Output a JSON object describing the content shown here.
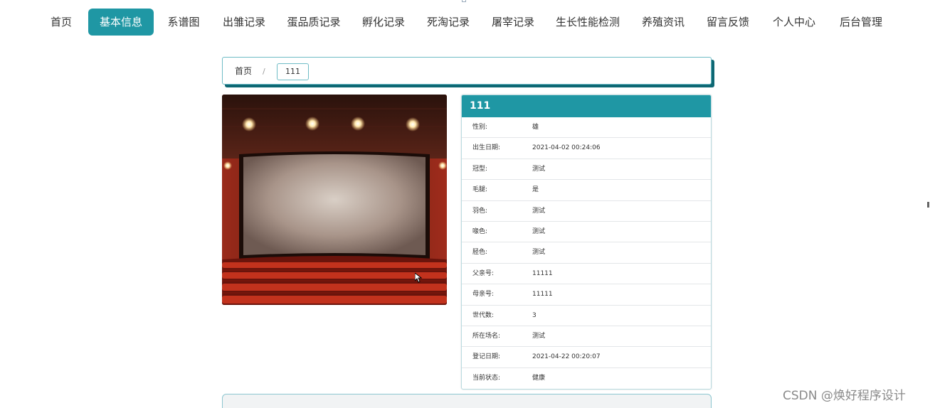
{
  "nav": {
    "items": [
      {
        "label": "首页"
      },
      {
        "label": "基本信息",
        "active": true
      },
      {
        "label": "系谱图"
      },
      {
        "label": "出雏记录"
      },
      {
        "label": "蛋品质记录"
      },
      {
        "label": "孵化记录"
      },
      {
        "label": "死淘记录"
      },
      {
        "label": "屠宰记录"
      },
      {
        "label": "生长性能检测"
      },
      {
        "label": "养殖资讯"
      },
      {
        "label": "留言反馈"
      },
      {
        "label": "个人中心"
      },
      {
        "label": "后台管理"
      }
    ]
  },
  "breadcrumb": {
    "home": "首页",
    "separator": "/",
    "current": "111"
  },
  "details": {
    "title": "111",
    "rows": [
      {
        "label": "性别:",
        "value": "雄"
      },
      {
        "label": "出生日期:",
        "value": "2021-04-02 00:24:06"
      },
      {
        "label": "冠型:",
        "value": "测试"
      },
      {
        "label": "毛腿:",
        "value": "是"
      },
      {
        "label": "羽色:",
        "value": "测试"
      },
      {
        "label": "喙色:",
        "value": "测试"
      },
      {
        "label": "胫色:",
        "value": "测试"
      },
      {
        "label": "父亲号:",
        "value": "11111"
      },
      {
        "label": "母亲号:",
        "value": "11111"
      },
      {
        "label": "世代数:",
        "value": "3"
      },
      {
        "label": "所在场名:",
        "value": "测试"
      },
      {
        "label": "登记日期:",
        "value": "2021-04-22 00:20:07"
      },
      {
        "label": "当前状态:",
        "value": "健康"
      }
    ]
  },
  "watermark": "CSDN @焕好程序设计",
  "colors": {
    "accent": "#1f97a4",
    "breadcrumb_shadow": "#0e6874",
    "border": "#6fbcc6"
  }
}
